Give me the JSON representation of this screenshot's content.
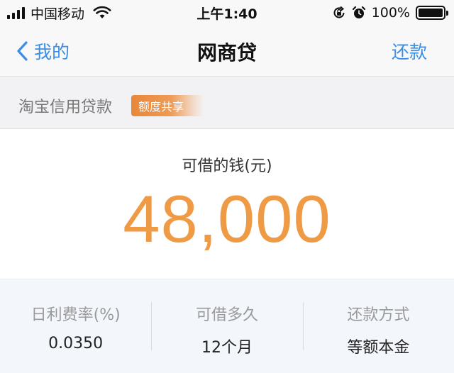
{
  "status_bar": {
    "carrier": "中国移动",
    "time": "上午1:40",
    "battery_percent": "100%",
    "battery_level": 1.0,
    "icons": [
      "signal-icon",
      "wifi-icon",
      "orientation-lock-icon",
      "alarm-icon",
      "battery-icon"
    ]
  },
  "nav": {
    "back_label": "我的",
    "title": "网商贷",
    "right_action": "还款"
  },
  "product": {
    "name": "淘宝信用贷款",
    "badge": "额度共享"
  },
  "amount": {
    "label": "可借的钱(元)",
    "value": "48,000"
  },
  "info": {
    "items": [
      {
        "label": "日利费率(%)",
        "value": "0.0350"
      },
      {
        "label": "可借多久",
        "value": "12个月"
      },
      {
        "label": "还款方式",
        "value": "等额本金"
      }
    ]
  },
  "colors": {
    "link_blue": "#3a8ee6",
    "amount_orange": "#ef9a45",
    "badge_orange": "#e8873a"
  }
}
